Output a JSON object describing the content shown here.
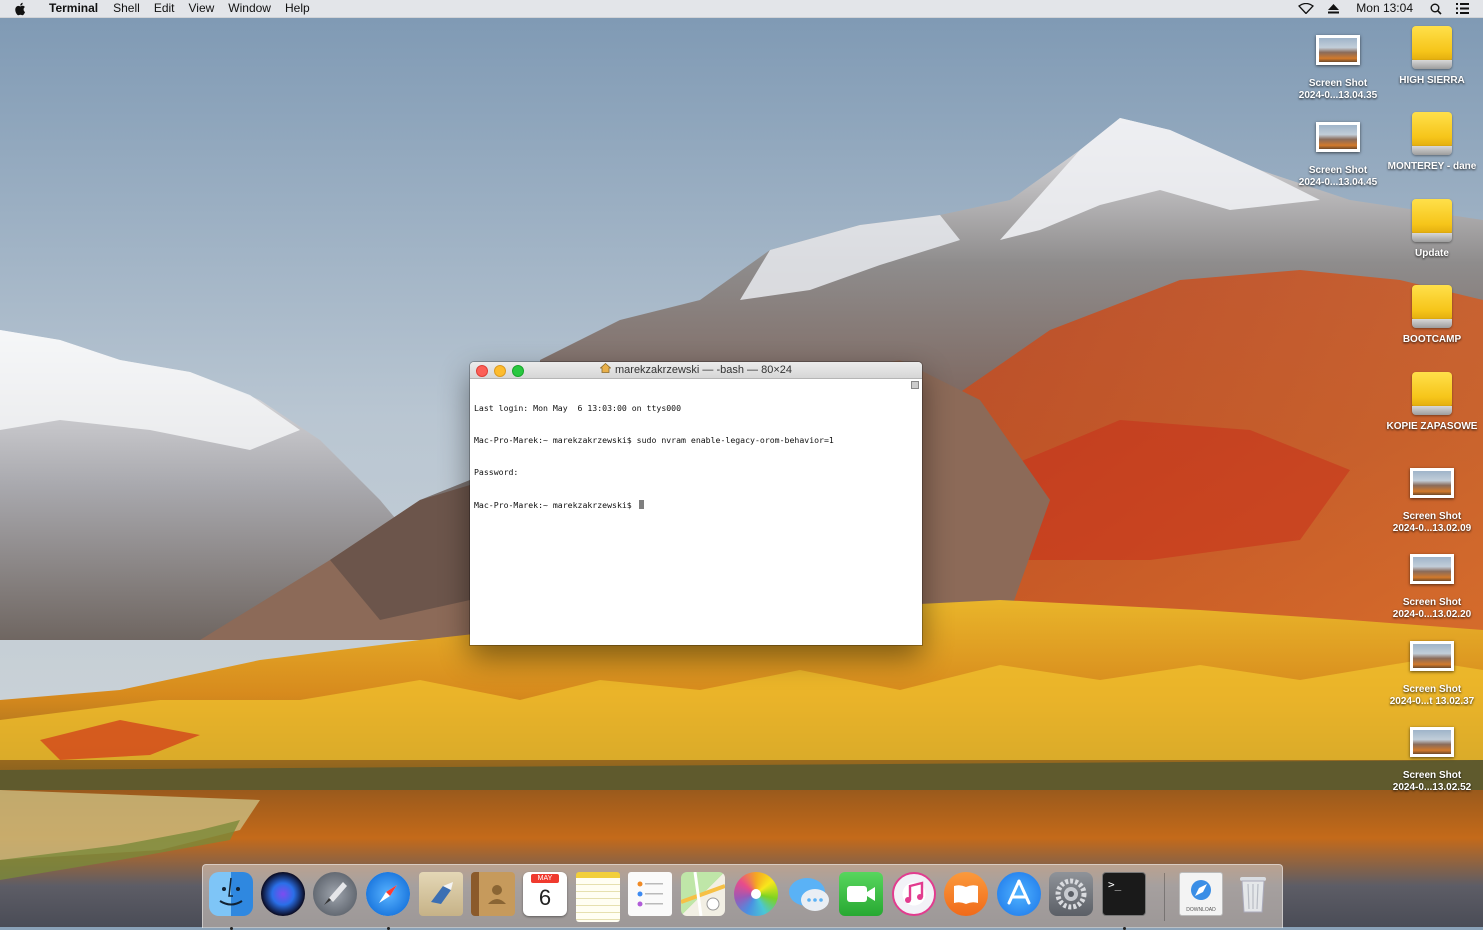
{
  "menubar": {
    "app_name": "Terminal",
    "menus": [
      "Shell",
      "Edit",
      "View",
      "Window",
      "Help"
    ],
    "clock": "Mon 13:04",
    "status_icons": [
      "wifi-icon",
      "eject-icon",
      "search-icon",
      "list-icon"
    ]
  },
  "desktop": {
    "col1": [
      {
        "line1": "Screen Shot",
        "line2": "2024-0...13.04.35",
        "kind": "screenshot"
      },
      {
        "line1": "Screen Shot",
        "line2": "2024-0...13.04.45",
        "kind": "screenshot"
      }
    ],
    "col2": [
      {
        "line1": "HIGH SIERRA",
        "line2": "",
        "kind": "drive"
      },
      {
        "line1": "MONTEREY - dane",
        "line2": "",
        "kind": "drive"
      },
      {
        "line1": "Update",
        "line2": "",
        "kind": "drive"
      },
      {
        "line1": "BOOTCAMP",
        "line2": "",
        "kind": "drive"
      },
      {
        "line1": "KOPIE ZAPASOWE",
        "line2": "",
        "kind": "drive"
      },
      {
        "line1": "Screen Shot",
        "line2": "2024-0...13.02.09",
        "kind": "screenshot"
      },
      {
        "line1": "Screen Shot",
        "line2": "2024-0...13.02.20",
        "kind": "screenshot"
      },
      {
        "line1": "Screen Shot",
        "line2": "2024-0...t 13.02.37",
        "kind": "screenshot"
      },
      {
        "line1": "Screen Shot",
        "line2": "2024-0...13.02.52",
        "kind": "screenshot"
      }
    ]
  },
  "terminal": {
    "title": "marekzakrzewski — -bash — 80×24",
    "lines": [
      "Last login: Mon May  6 13:03:00 on ttys000",
      "Mac-Pro-Marek:~ marekzakrzewski$ sudo nvram enable-legacy-orom-behavior=1",
      "Password:",
      "Mac-Pro-Marek:~ marekzakrzewski$ "
    ]
  },
  "dock": {
    "calendar_month": "MAY",
    "calendar_day": "6",
    "apps": [
      "finder",
      "siri",
      "launchpad",
      "safari",
      "mail",
      "contacts",
      "calendar",
      "notes",
      "reminders",
      "maps",
      "photos",
      "messages",
      "facetime",
      "itunes",
      "ibooks",
      "app-store",
      "system-preferences",
      "terminal",
      "downloads",
      "trash"
    ],
    "downloads_label": "DOWNLOAD"
  },
  "colors": {
    "menubar_bg": "#ececee",
    "close": "#fc5f57",
    "minimize": "#fdbc2e",
    "maximize": "#29c840",
    "drive_yellow": "#f6c51a"
  }
}
